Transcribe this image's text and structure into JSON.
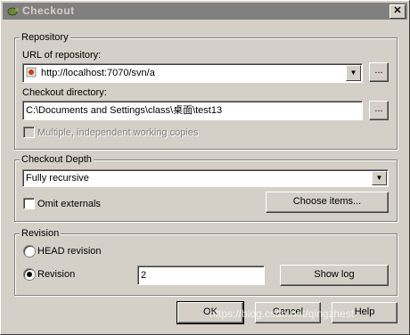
{
  "window": {
    "title": "Checkout",
    "close_glyph": "✕"
  },
  "repository": {
    "group_label": "Repository",
    "url_label": "URL of repository:",
    "url_value": "http://localhost:7070/svn/a",
    "dir_label": "Checkout directory:",
    "dir_value": "C:\\Documents and Settings\\class\\桌面\\test13",
    "browse_label": "...",
    "multiple_label": "Multiple, independent working copies"
  },
  "depth": {
    "group_label": "Checkout Depth",
    "value": "Fully recursive",
    "omit_label": "Omit externals",
    "choose_label": "Choose items..."
  },
  "revision": {
    "group_label": "Revision",
    "head_label": "HEAD revision",
    "rev_label": "Revision",
    "rev_value": "2",
    "show_log_label": "Show log",
    "selected": "revision"
  },
  "buttons": {
    "ok": "OK",
    "cancel": "Cancel",
    "help": "Help"
  },
  "watermark": "https://blog.csdn.net/qingzhest"
}
